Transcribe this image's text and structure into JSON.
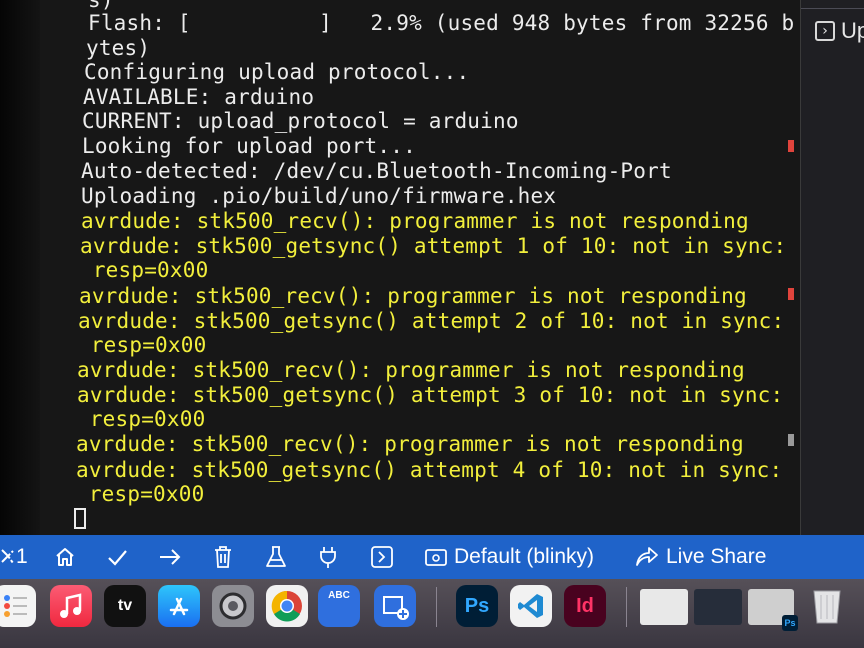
{
  "terminal": {
    "lines": [
      {
        "text": "s)",
        "color": "white"
      },
      {
        "text": "Flash: [          ]   2.9% (used 948 bytes from 32256 b",
        "color": "white"
      },
      {
        "text": "ytes)",
        "color": "white"
      },
      {
        "text": "Configuring upload protocol...",
        "color": "white"
      },
      {
        "text": "AVAILABLE: arduino",
        "color": "white"
      },
      {
        "text": "CURRENT: upload_protocol = arduino",
        "color": "white"
      },
      {
        "text": "Looking for upload port...",
        "color": "white"
      },
      {
        "text": "Auto-detected: /dev/cu.Bluetooth-Incoming-Port",
        "color": "white"
      },
      {
        "text": "Uploading .pio/build/uno/firmware.hex",
        "color": "white"
      },
      {
        "text": "avrdude: stk500_recv(): programmer is not responding",
        "color": "yellow"
      },
      {
        "text": "avrdude: stk500_getsync() attempt 1 of 10: not in sync:",
        "color": "yellow"
      },
      {
        "text": " resp=0x00",
        "color": "yellow"
      },
      {
        "text": "avrdude: stk500_recv(): programmer is not responding",
        "color": "yellow"
      },
      {
        "text": "avrdude: stk500_getsync() attempt 2 of 10: not in sync:",
        "color": "yellow"
      },
      {
        "text": " resp=0x00",
        "color": "yellow"
      },
      {
        "text": "avrdude: stk500_recv(): programmer is not responding",
        "color": "yellow"
      },
      {
        "text": "avrdude: stk500_getsync() attempt 3 of 10: not in sync:",
        "color": "yellow"
      },
      {
        "text": " resp=0x00",
        "color": "yellow"
      },
      {
        "text": "avrdude: stk500_recv(): programmer is not responding",
        "color": "yellow"
      },
      {
        "text": "avrdude: stk500_getsync() attempt 4 of 10: not in sync:",
        "color": "yellow"
      },
      {
        "text": " resp=0x00",
        "color": "yellow"
      }
    ],
    "colors": {
      "white": "#ececec",
      "yellow": "#f2ef3c",
      "background": "#171717"
    }
  },
  "right_panel": {
    "item_label": "Up",
    "item_icon": "chevron-right-box-icon"
  },
  "status_bar": {
    "background": "#1f63c9",
    "remote_count": "1",
    "items": [
      {
        "name": "home-icon"
      },
      {
        "name": "checkmark-icon"
      },
      {
        "name": "arrow-right-icon"
      },
      {
        "name": "trash-icon"
      },
      {
        "name": "flask-icon"
      },
      {
        "name": "plug-icon"
      },
      {
        "name": "terminal-icon"
      }
    ],
    "project_env": "Default (blinky)",
    "live_share": "Live Share"
  },
  "dock": {
    "apps": [
      {
        "name": "reminders-app-icon"
      },
      {
        "name": "music-app-icon"
      },
      {
        "name": "apple-tv-app-icon",
        "label": "tv"
      },
      {
        "name": "app-store-app-icon"
      },
      {
        "name": "system-preferences-app-icon"
      },
      {
        "name": "chrome-app-icon"
      },
      {
        "name": "photo-editor-app-icon-1",
        "label": "ABC"
      },
      {
        "name": "photo-editor-app-icon-2"
      },
      {
        "name": "photoshop-app-icon",
        "label": "Ps"
      },
      {
        "name": "vscode-app-icon"
      },
      {
        "name": "indesign-app-icon",
        "label": "Id"
      },
      {
        "name": "trash-app-icon"
      }
    ],
    "recent_badge_label": "Ps"
  }
}
